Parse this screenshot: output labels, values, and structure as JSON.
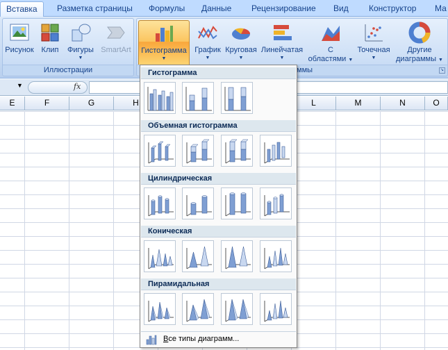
{
  "tabs": [
    {
      "label": "Вставка",
      "active": true
    },
    {
      "label": "Разметка страницы"
    },
    {
      "label": "Формулы"
    },
    {
      "label": "Данные"
    },
    {
      "label": "Рецензирование"
    },
    {
      "label": "Вид"
    },
    {
      "label": "Конструктор"
    },
    {
      "label": "Ма"
    }
  ],
  "ribbon": {
    "illustrations": {
      "label": "Иллюстрации",
      "buttons": [
        "Рисунок",
        "Клип",
        "Фигуры",
        "SmartArt"
      ]
    },
    "charts": {
      "label_visible": "ммы",
      "buttons": [
        "Гистограмма",
        "График",
        "Круговая",
        "Линейчатая",
        "С",
        "областями",
        "Точечная",
        "Другие",
        "диаграммы"
      ]
    }
  },
  "formula_bar": {
    "fx": "fx"
  },
  "columns": [
    "E",
    "F",
    "G",
    "H",
    "L",
    "M",
    "N",
    "O"
  ],
  "gallery": {
    "sections": [
      "Гистограмма",
      "Объемная гистограмма",
      "Цилиндрическая",
      "Коническая",
      "Пирамидальная"
    ],
    "footer": "Все типы диаграмм..."
  },
  "colors": {
    "accent": "#15428b",
    "bar_fill": "#7f9fd3",
    "bar_light": "#c9d8f0"
  }
}
